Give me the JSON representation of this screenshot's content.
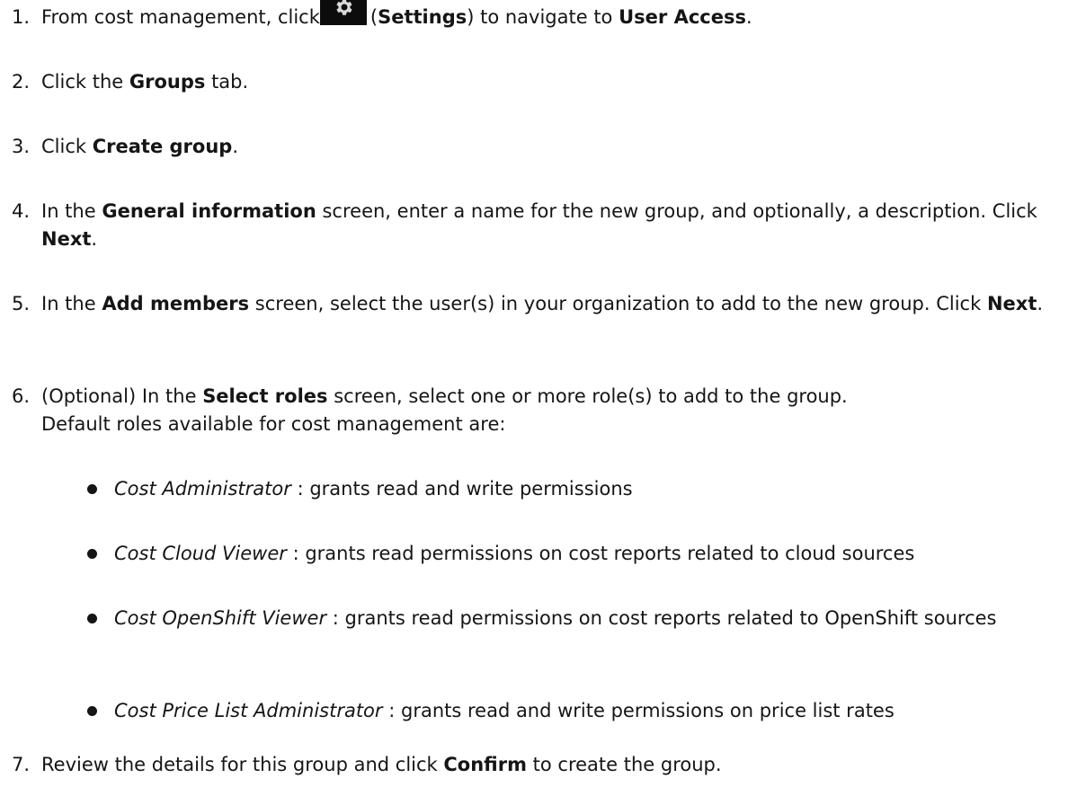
{
  "steps": [
    {
      "num": "1.",
      "pre": "From cost management, click",
      "icon": "settings-gear-icon",
      "open": "(",
      "bold1": "Settings",
      "mid": ") to navigate to",
      "bold2": "User Access",
      "end": "."
    },
    {
      "num": "2.",
      "pre": "Click the",
      "bold1": "Groups",
      "end": " tab."
    },
    {
      "num": "3.",
      "pre": "Click",
      "bold1": "Create group",
      "end": "."
    },
    {
      "num": "4.",
      "pre": "In the",
      "bold1": "General information",
      "mid": "screen, enter a name for the new group, and optionally, a description. Click",
      "bold2": "Next",
      "end": "."
    },
    {
      "num": "5.",
      "pre": "In the",
      "bold1": "Add members",
      "mid": "screen, select the user(s) in your organization to add to the new group. Click",
      "bold2": "Next",
      "end": "."
    },
    {
      "num": "6.",
      "pre": "(Optional) In the",
      "bold1": "Select roles",
      "mid": "screen, select one or more role(s) to add to the group.",
      "line2": "Default roles available for cost management are:"
    },
    {
      "num": "7.",
      "pre": "Review the details for this group and click",
      "bold1": "Confirm",
      "end": " to create the group."
    }
  ],
  "roles": [
    {
      "name": "Cost Administrator",
      "desc": ": grants read and write permissions"
    },
    {
      "name": "Cost Cloud Viewer",
      "desc": ": grants read permissions on cost reports related to cloud sources"
    },
    {
      "name": "Cost OpenShift Viewer",
      "desc": ": grants read permissions on cost reports related to OpenShift sources"
    },
    {
      "name": "Cost Price List Administrator",
      "desc": ": grants read and write permissions on price list rates"
    }
  ]
}
